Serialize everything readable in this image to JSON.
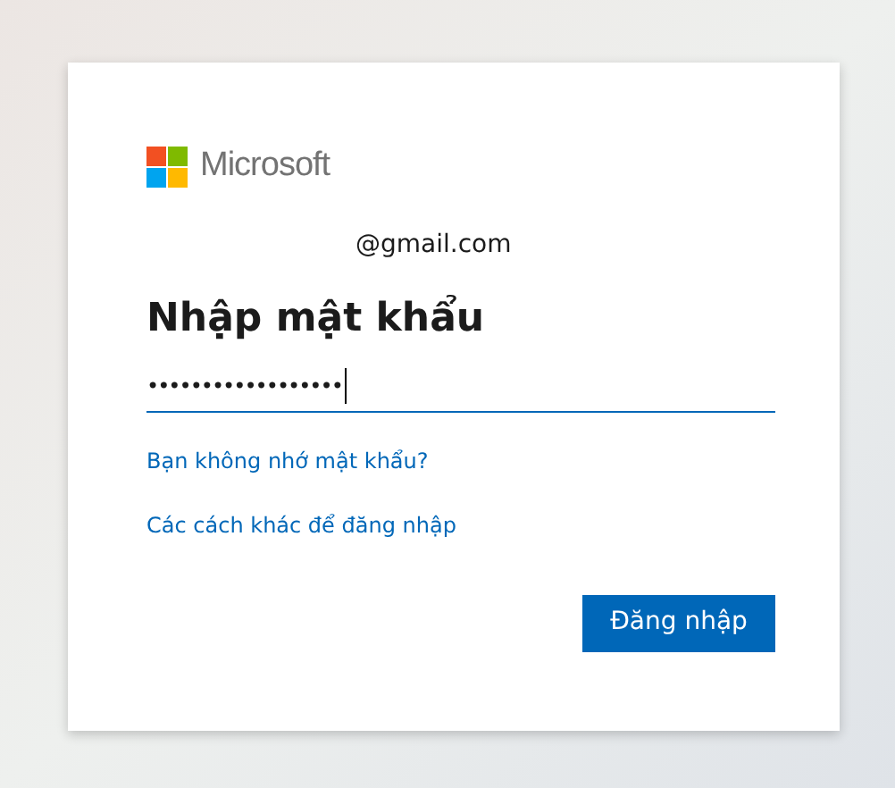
{
  "logo": {
    "text": "Microsoft"
  },
  "account": {
    "email": "@gmail.com"
  },
  "title": "Nhập mật khẩu",
  "password_field": {
    "value": "••••••••••••••••••",
    "focused": true
  },
  "links": [
    {
      "label": "Bạn không nhớ mật khẩu?"
    },
    {
      "label": "Các cách khác để đăng nhập"
    }
  ],
  "buttons": [
    {
      "label": "Đăng nhập"
    }
  ]
}
